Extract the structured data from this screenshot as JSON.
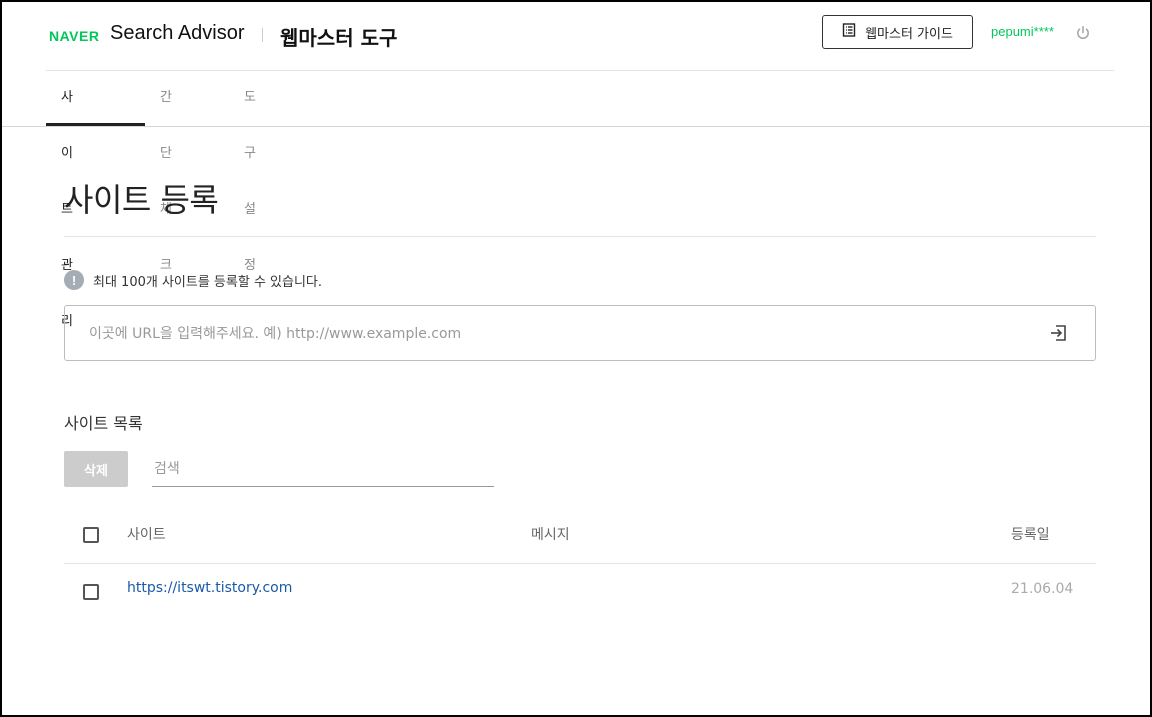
{
  "header": {
    "naver_logo": "NAVER",
    "product": "Search Advisor",
    "tool_title": "웹마스터 도구",
    "guide_button": "웹마스터 가이드",
    "user": "pepumi****",
    "brand_color": "#03c75a"
  },
  "tabs": [
    {
      "label": "사이트 관리",
      "active": true
    },
    {
      "label": "간단체크",
      "active": false
    },
    {
      "label": "도구 설정",
      "active": false
    }
  ],
  "page": {
    "title": "사이트 등록",
    "notice": "최대 100개 사이트를 등록할 수 있습니다.",
    "notice_icon": "!",
    "url_placeholder": "이곳에 URL을 입력해주세요. 예) http://www.example.com"
  },
  "site_list": {
    "title": "사이트 목록",
    "delete_button": "삭제",
    "search_placeholder": "검색",
    "columns": [
      "사이트",
      "메시지",
      "등록일"
    ],
    "rows": [
      {
        "site": "https://itswt.tistory.com",
        "message": "",
        "date": "21.06.04"
      }
    ]
  },
  "icons": {
    "guide": "book-icon",
    "logout": "power-icon",
    "notice": "info-icon",
    "submit": "enter-icon"
  }
}
